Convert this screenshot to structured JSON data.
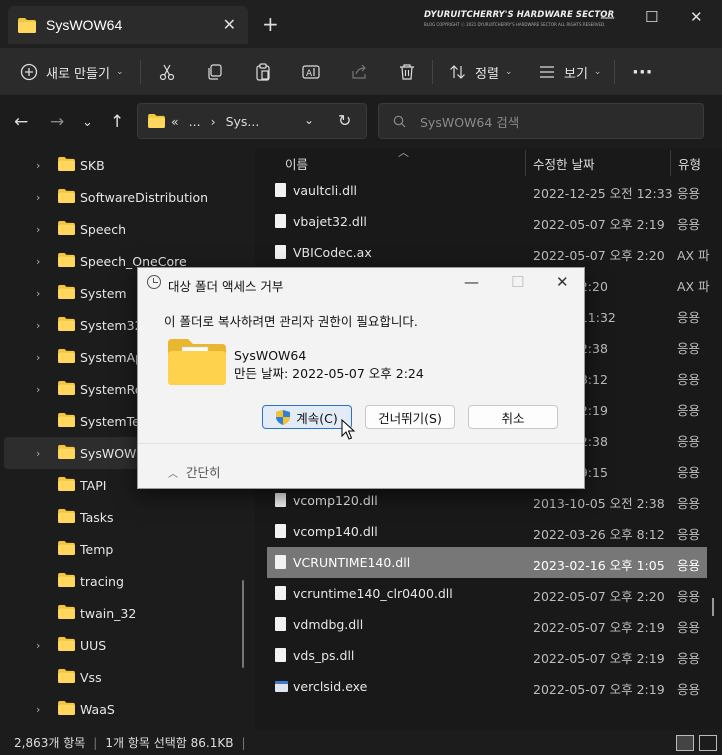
{
  "window": {
    "tab_title": "SysWOW64",
    "tab_close": "✕",
    "new_tab": "+",
    "watermark_line1": "DYURUITCHERRY'S HARDWARE SECTOR",
    "watermark_line2": "BLOG COPYRIGHT ⓒ 2021 DYURUITCHERRY'S HARDWARE SECTOR ALL RIGHTS RESERVED.",
    "minimize": "—",
    "maximize": "☐",
    "close": "✕"
  },
  "toolbar": {
    "new_label": "새로 만들기",
    "sort_label": "정렬",
    "view_label": "보기",
    "more_label": "···"
  },
  "nav": {
    "address_prefix": "«",
    "address_ellipsis": "...",
    "address_current": "Sys...",
    "search_placeholder": "SysWOW64 검색"
  },
  "sidebar": {
    "items": [
      {
        "label": "SKB"
      },
      {
        "label": "SoftwareDistribution"
      },
      {
        "label": "Speech"
      },
      {
        "label": "Speech_OneCore"
      },
      {
        "label": "System"
      },
      {
        "label": "System32"
      },
      {
        "label": "SystemApps"
      },
      {
        "label": "SystemResources"
      },
      {
        "label": "SystemTemp"
      },
      {
        "label": "SysWOW64"
      },
      {
        "label": "TAPI"
      },
      {
        "label": "Tasks"
      },
      {
        "label": "Temp"
      },
      {
        "label": "tracing"
      },
      {
        "label": "twain_32"
      },
      {
        "label": "UUS"
      },
      {
        "label": "Vss"
      },
      {
        "label": "WaaS"
      }
    ]
  },
  "files": {
    "columns": {
      "name": "이름",
      "date": "수정한 날짜",
      "type": "유형"
    },
    "rows": [
      {
        "name": "vaultcli.dll",
        "date": "2022-12-25 오전 12:33",
        "type": "응용"
      },
      {
        "name": "vbajet32.dll",
        "date": "2022-05-07 오후 2:19",
        "type": "응용"
      },
      {
        "name": "VBICodec.ax",
        "date": "2022-05-07 오후 2:20",
        "type": "AX 파"
      },
      {
        "name": "",
        "date": "07 오후 2:20",
        "type": "AX 파"
      },
      {
        "name": "",
        "date": "25 오전 11:32",
        "type": "응용"
      },
      {
        "name": "",
        "date": "05 오전 2:38",
        "type": "응용"
      },
      {
        "name": "",
        "date": "26 오후 8:12",
        "type": "응용"
      },
      {
        "name": "",
        "date": "07 오후 2:19",
        "type": "응용"
      },
      {
        "name": "",
        "date": "05 오전 2:38",
        "type": "응용"
      },
      {
        "name": "",
        "date": "18 오후 9:15",
        "type": "응용"
      },
      {
        "name": "vcomp120.dll",
        "date": "2013-10-05 오전 2:38",
        "type": "응용"
      },
      {
        "name": "vcomp140.dll",
        "date": "2022-03-26 오후 8:12",
        "type": "응용"
      },
      {
        "name": "VCRUNTIME140.dll",
        "date": "2023-02-16 오후 1:05",
        "type": "응용"
      },
      {
        "name": "vcruntime140_clr0400.dll",
        "date": "2022-05-07 오후 2:20",
        "type": "응용"
      },
      {
        "name": "vdmdbg.dll",
        "date": "2022-05-07 오후 2:19",
        "type": "응용"
      },
      {
        "name": "vds_ps.dll",
        "date": "2022-05-07 오후 2:19",
        "type": "응용"
      },
      {
        "name": "verclsid.exe",
        "date": "2022-05-07 오후 2:19",
        "type": "응용"
      }
    ]
  },
  "status": {
    "count": "2,863개 항목",
    "selection": "1개 항목 선택함 86.1KB"
  },
  "dialog": {
    "title": "대상 폴더 액세스 거부",
    "message": "이 폴더로 복사하려면 관리자 권한이 필요합니다.",
    "folder_name": "SysWOW64",
    "folder_date": "만든 날짜: 2022-05-07 오후 2:24",
    "continue_label": "계속(C)",
    "skip_label": "건너뛰기(S)",
    "cancel_label": "취소",
    "less_label": "간단히",
    "minimize": "—",
    "maximize": "☐",
    "close": "✕"
  },
  "colors": {
    "accent": "#2a73c4",
    "folder": "#f2c53d",
    "dark_bg": "#1c1c1c"
  }
}
